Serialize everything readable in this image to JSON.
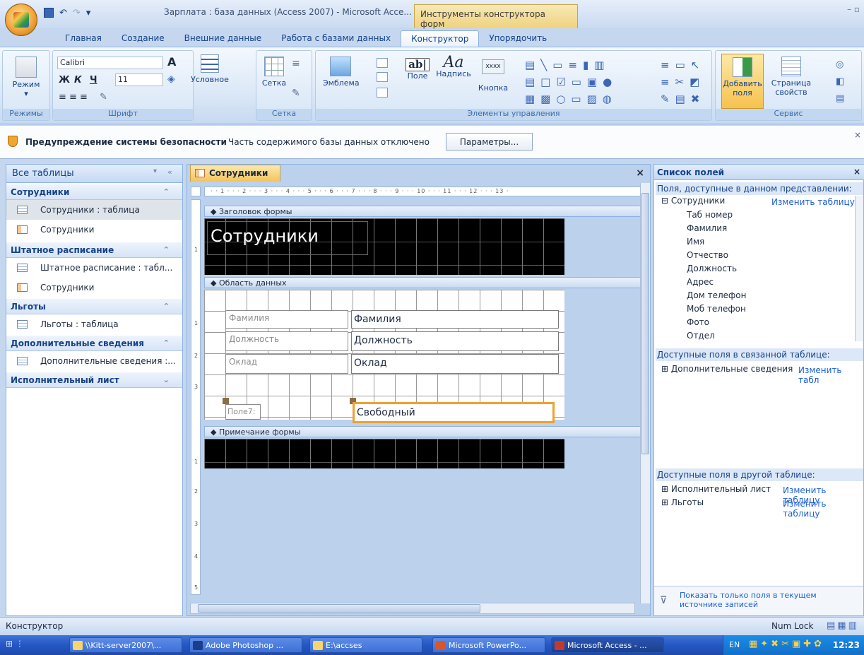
{
  "titlebar": {
    "app_title": "Зарплата : база данных (Access 2007) - Microsoft Acce...",
    "contextual_title": "Инструменты конструктора форм",
    "window_controls": "–  ▫"
  },
  "tabs": [
    "Главная",
    "Создание",
    "Внешние данные",
    "Работа с базами данных",
    "Конструктор",
    "Упорядочить"
  ],
  "active_tab": "Конструктор",
  "ribbon": {
    "view_label": "Режим",
    "font_name": "Calibri",
    "font_size": "11",
    "bold": "Ж",
    "italic": "К",
    "underline": "Ч",
    "conditional_label": "Условное",
    "grid_label": "Сетка",
    "logo_label": "Эмблема",
    "field_label": "Поле",
    "caption_label": "Надпись",
    "button_label": "Кнопка",
    "add_fields_label": "Добавить поля",
    "properties_label": "Страница свойств",
    "group_views": "Режимы",
    "group_font": "Шрифт",
    "group_grid": "Сетка",
    "group_controls": "Элементы управления",
    "group_tools": "Сервис",
    "textbox_icon_text": "ab|",
    "label_icon_text": "Aa",
    "button_icon_text": "xxxx"
  },
  "security": {
    "title": "Предупреждение системы безопасности",
    "text": "Часть содержимого базы данных отключено",
    "button": "Параметры..."
  },
  "nav": {
    "header": "Все таблицы",
    "groups": [
      {
        "label": "Сотрудники",
        "items": [
          "Сотрудники : таблица",
          "Сотрудники"
        ]
      },
      {
        "label": "Штатное расписание",
        "items": [
          "Штатное расписание : табл...",
          "Сотрудники"
        ]
      },
      {
        "label": "Льготы",
        "items": [
          "Льготы : таблица"
        ]
      },
      {
        "label": "Дополнительные сведения",
        "items": [
          "Дополнительные сведения :..."
        ]
      },
      {
        "label": "Исполнительный лист",
        "items": []
      }
    ]
  },
  "designer": {
    "doc_tab": "Сотрудники",
    "ruler": "· · 1 · · · 2 · · · 3 · · · 4 · · · 5 · · · 6 · · · 7 · · · 8 · · · 9 · · · 10 · · · 11 · · · 12 · · · 13 ·",
    "ruler_left_marks": [
      "1",
      "1",
      "2",
      "3",
      "1",
      "2",
      "3",
      "4",
      "5"
    ],
    "header_section": "Заголовок формы",
    "form_title": "Сотрудники",
    "detail_section": "Область данных",
    "footer_section": "Примечание формы",
    "rows": [
      {
        "label": "Фамилия",
        "field": "Фамилия"
      },
      {
        "label": "Должность",
        "field": "Должность"
      },
      {
        "label": "Оклад",
        "field": "Оклад"
      },
      {
        "label": "Поле7:",
        "field": "Свободный"
      }
    ]
  },
  "fieldlist": {
    "header": "Список полей",
    "caption_current": "Поля, доступные в данном представлении:",
    "table": "Сотрудники",
    "edit_link": "Изменить таблицу",
    "fields": [
      "Таб номер",
      "Фамилия",
      "Имя",
      "Отчество",
      "Должность",
      "Адрес",
      "Дом телефон",
      "Моб телефон",
      "Фото",
      "Отдел"
    ],
    "caption_related": "Доступные поля в связанной таблице:",
    "related_table": "Дополнительные сведения",
    "related_link": "Изменить табл",
    "caption_other": "Доступные поля в другой таблице:",
    "other_tables": [
      {
        "name": "Исполнительный лист",
        "link": "Изменить таблицу"
      },
      {
        "name": "Льготы",
        "link": "Изменить таблицу"
      }
    ],
    "show_only": "Показать только поля в текущем источнике записей"
  },
  "status": {
    "mode": "Конструктор",
    "numlock": "Num Lock"
  },
  "taskbar": {
    "tasks": [
      "\\\\Kitt-server2007\\...",
      "Adobe Photoshop ...",
      "E:\\accses",
      "Microsoft PowerPo...",
      "Microsoft Access - ..."
    ],
    "lang": "EN",
    "clock": "12:23"
  }
}
